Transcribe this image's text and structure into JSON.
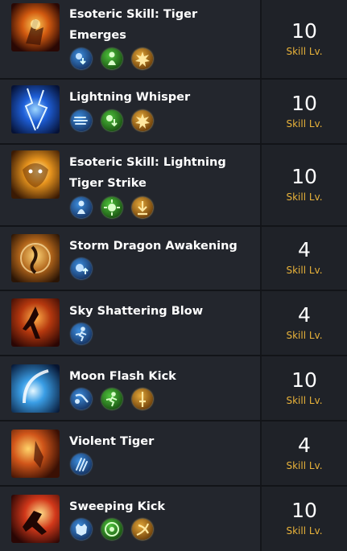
{
  "skills": [
    {
      "name_lines": [
        "Esoteric Skill: Tiger",
        "Emerges"
      ],
      "level": "10",
      "level_label": "Skill Lv.",
      "icon": "tiger-emerges-icon",
      "tripods": [
        {
          "icon": "blue-down-arrow-icon",
          "color": "blue"
        },
        {
          "icon": "green-person-icon",
          "color": "green"
        },
        {
          "icon": "gold-explosion-icon",
          "color": "gold"
        }
      ]
    },
    {
      "name_lines": [
        "Lightning Whisper"
      ],
      "level": "10",
      "level_label": "Skill Lv.",
      "icon": "lightning-whisper-icon",
      "tripods": [
        {
          "icon": "blue-wind-icon",
          "color": "blue"
        },
        {
          "icon": "green-down-arrow-icon",
          "color": "green"
        },
        {
          "icon": "gold-explosion-icon",
          "color": "gold"
        }
      ]
    },
    {
      "name_lines": [
        "Esoteric Skill: Lightning",
        "Tiger Strike"
      ],
      "level": "10",
      "level_label": "Skill Lv.",
      "icon": "lightning-tiger-strike-icon",
      "tripods": [
        {
          "icon": "blue-person-icon",
          "color": "blue"
        },
        {
          "icon": "green-burst-icon",
          "color": "green"
        },
        {
          "icon": "gold-down-arrow-icon",
          "color": "gold"
        }
      ]
    },
    {
      "name_lines": [
        "Storm Dragon Awakening"
      ],
      "level": "4",
      "level_label": "Skill Lv.",
      "icon": "storm-dragon-awakening-icon",
      "tripods": [
        {
          "icon": "blue-orb-up-icon",
          "color": "blue"
        }
      ]
    },
    {
      "name_lines": [
        "Sky Shattering Blow"
      ],
      "level": "4",
      "level_label": "Skill Lv.",
      "icon": "sky-shattering-blow-icon",
      "tripods": [
        {
          "icon": "blue-running-icon",
          "color": "blue"
        }
      ]
    },
    {
      "name_lines": [
        "Moon Flash Kick"
      ],
      "level": "10",
      "level_label": "Skill Lv.",
      "icon": "moon-flash-kick-icon",
      "tripods": [
        {
          "icon": "blue-kick-icon",
          "color": "blue"
        },
        {
          "icon": "green-running-icon",
          "color": "green"
        },
        {
          "icon": "gold-sword-icon",
          "color": "gold"
        }
      ]
    },
    {
      "name_lines": [
        "Violent Tiger"
      ],
      "level": "4",
      "level_label": "Skill Lv.",
      "icon": "violent-tiger-icon",
      "tripods": [
        {
          "icon": "blue-claw-icon",
          "color": "blue"
        }
      ]
    },
    {
      "name_lines": [
        "Sweeping Kick"
      ],
      "level": "10",
      "level_label": "Skill Lv.",
      "icon": "sweeping-kick-icon",
      "tripods": [
        {
          "icon": "blue-beast-icon",
          "color": "blue"
        },
        {
          "icon": "green-target-icon",
          "color": "green"
        },
        {
          "icon": "gold-slash-icon",
          "color": "gold"
        }
      ]
    }
  ],
  "colors": {
    "level_label": "#e8b23a",
    "row_bg": "#23262d",
    "level_bg": "#1f2228"
  }
}
